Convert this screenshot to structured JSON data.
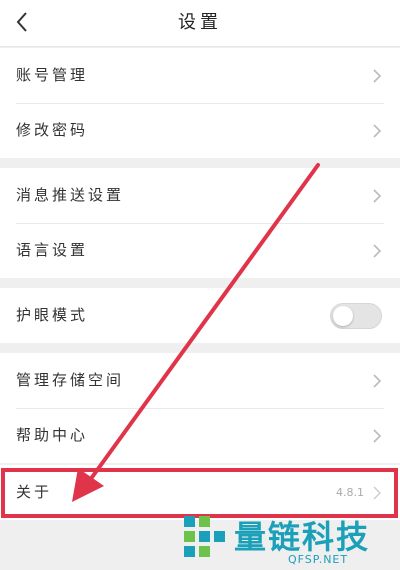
{
  "header": {
    "title": "设置",
    "back_icon": "chevron-left-icon"
  },
  "groups": [
    {
      "items": [
        {
          "label": "账号管理"
        },
        {
          "label": "修改密码"
        }
      ]
    },
    {
      "items": [
        {
          "label": "消息推送设置"
        },
        {
          "label": "语言设置"
        }
      ]
    },
    {
      "items": [
        {
          "label": "护眼模式",
          "toggle_on": false
        }
      ]
    },
    {
      "items": [
        {
          "label": "管理存储空间"
        },
        {
          "label": "帮助中心"
        }
      ]
    },
    {
      "items": [
        {
          "label": "关于",
          "value": "4.8.1"
        }
      ]
    }
  ],
  "annotation": {
    "arrow_color": "#e0344b",
    "highlight_color": "#e0344b"
  },
  "watermark": {
    "text": "量链科技",
    "sub": "QFSP.NET",
    "color": "#1aa0b8"
  }
}
